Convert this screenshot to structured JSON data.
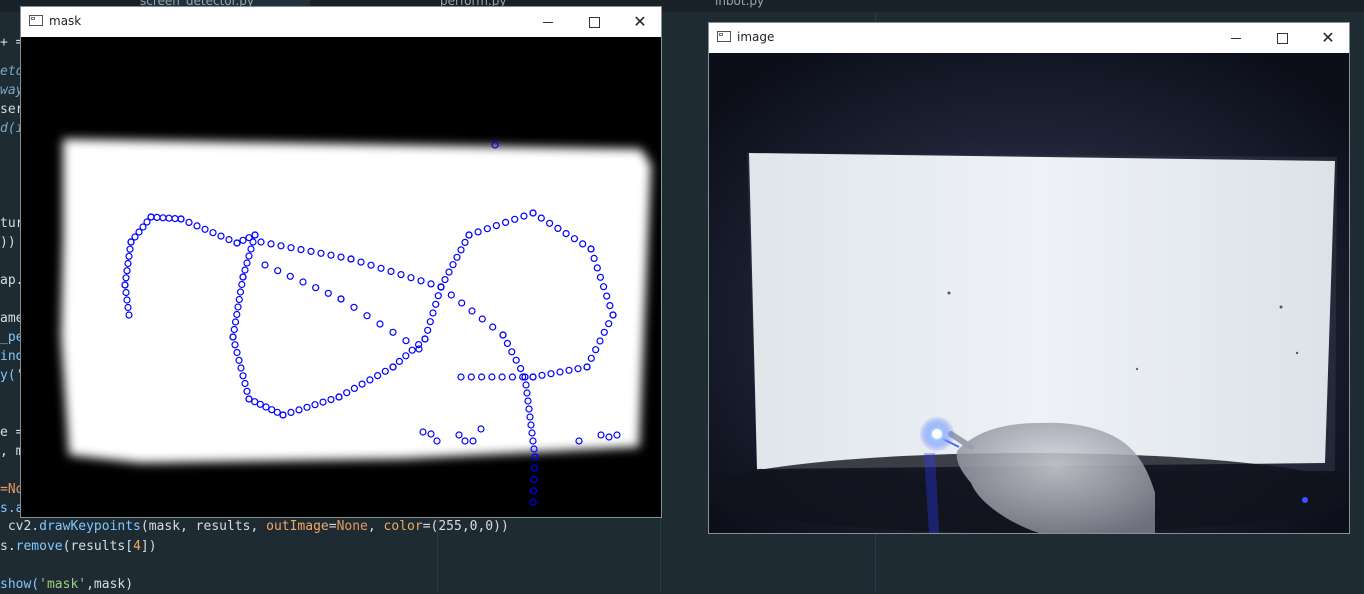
{
  "editor": {
    "tabs": [
      "screen_detector.py",
      "perform.py",
      "inbot.py"
    ],
    "code_lines": [
      {
        "text": "+ ="
      },
      {
        "text": "etor",
        "style": "ital"
      },
      {
        "text": "way",
        "style": "ital"
      },
      {
        "text": "sers"
      },
      {
        "text": "d(in",
        "style": "ital"
      },
      {
        "text": "ture"
      },
      {
        "text": "))"
      },
      {
        "text": "ap.m"
      },
      {
        "text": "ame"
      },
      {
        "text": "_per"
      },
      {
        "text": "indo"
      },
      {
        "text": "y('r"
      },
      {
        "text": "e ="
      },
      {
        "text": ", m"
      },
      {
        "text": "=No"
      },
      {
        "text": "s.ap"
      }
    ],
    "draw_keypoints": {
      "prefix": " cv2.",
      "fn": "drawKeypoints",
      "args_open": "(mask, results, ",
      "outimage_kw": "outImage",
      "outimage_val": "None",
      "color_kw": "color",
      "color_val": "(255,0,0))"
    },
    "remove_line": {
      "prefix": "s.",
      "fn": "remove",
      "arg": "(results[",
      "idx": "4",
      "close": "])"
    },
    "show_line": {
      "prefix": "show(",
      "str": "'mask'",
      "rest": ",mask)"
    }
  },
  "windows": {
    "mask": {
      "title": "mask"
    },
    "image": {
      "title": "image"
    }
  },
  "colors": {
    "keypoint": "#0000ff",
    "mask_bg": "#000000",
    "mask_fg": "#ffffff"
  },
  "icons": {
    "minimize": "minimize-icon",
    "maximize": "maximize-icon",
    "close": "close-icon"
  },
  "close_glyph": "✕"
}
